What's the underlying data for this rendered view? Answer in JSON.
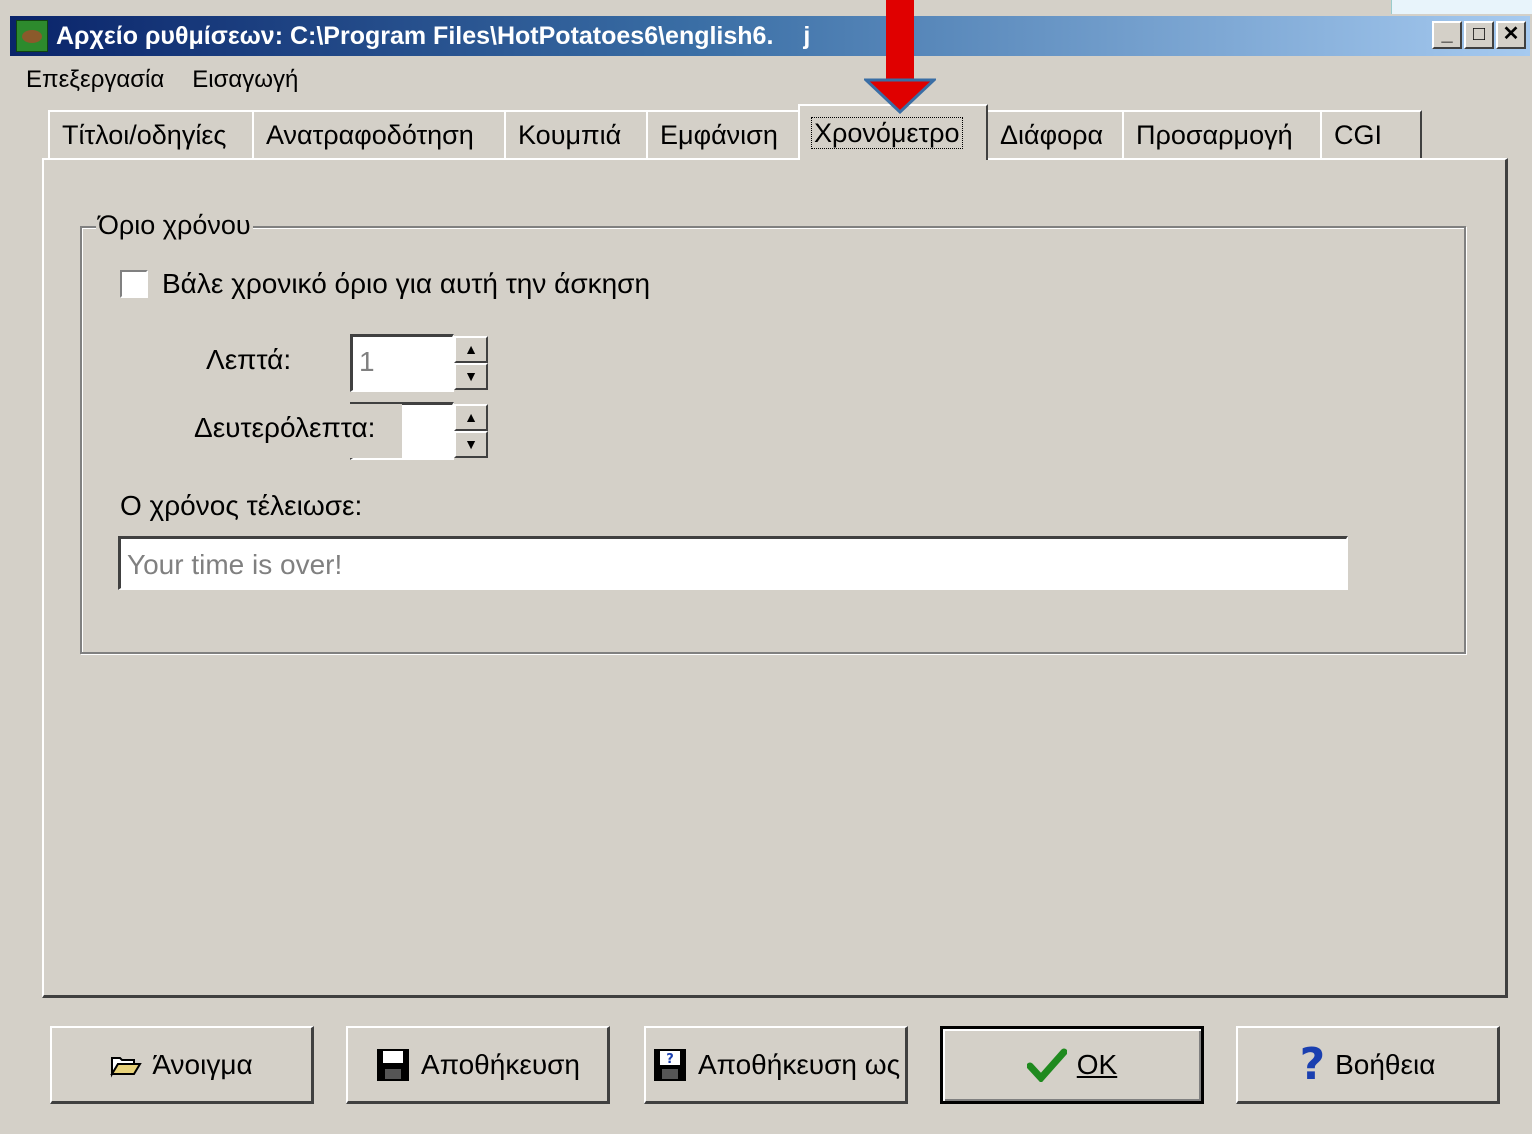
{
  "window": {
    "title": "Αρχείο ρυθμίσεων: C:\\Program Files\\HotPotatoes6\\english6.",
    "title_tail": "j",
    "minimize": "_",
    "maximize": "□",
    "close": "✕"
  },
  "menu": [
    "Επεξεργασία",
    "Εισαγωγή"
  ],
  "tabs": [
    {
      "label": "Τίτλοι/οδηγίες"
    },
    {
      "label": "Ανατραφοδότηση"
    },
    {
      "label": "Κουμπιά"
    },
    {
      "label": "Εμφάνιση"
    },
    {
      "label": "Χρονόμετρο",
      "active": true
    },
    {
      "label": "Διάφορα"
    },
    {
      "label": "Προσαρμογή"
    },
    {
      "label": "CGI"
    }
  ],
  "time_limit": {
    "group_title": "Όριο χρόνου",
    "checkbox_label": "Βάλε χρονικό όριο για αυτή την άσκηση",
    "checked": false,
    "minutes_label": "Λεπτά:",
    "minutes_value": "1",
    "seconds_label": "Δευτερόλεπτα:",
    "seconds_value": "",
    "timeout_label": "Ο χρόνος τέλειωσε:",
    "timeout_message": "Your time is over!"
  },
  "buttons": {
    "open": "Άνοιγμα",
    "save": "Αποθήκευση",
    "save_as": "Αποθήκευση ως",
    "ok": "OK",
    "help": "Βοήθεια"
  },
  "icons": {
    "open": "folder-open-icon",
    "save": "floppy-disk-icon",
    "save_as": "floppy-disk-question-icon",
    "ok": "checkmark-icon",
    "help": "question-mark-icon"
  },
  "colors": {
    "annotation_arrow": "#e00000",
    "ok_check": "#1f8a1f",
    "help_mark": "#1a3fb0"
  }
}
